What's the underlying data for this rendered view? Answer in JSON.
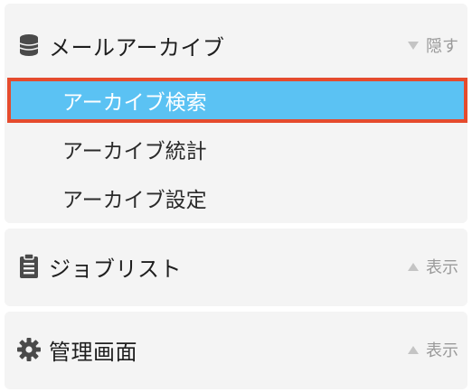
{
  "archive": {
    "title": "メールアーカイブ",
    "toggle": "隠す",
    "items": [
      {
        "label": "アーカイブ検索"
      },
      {
        "label": "アーカイブ統計"
      },
      {
        "label": "アーカイブ設定"
      }
    ],
    "icon": "database-icon"
  },
  "jobs": {
    "title": "ジョブリスト",
    "toggle": "表示",
    "icon": "clipboard-list-icon"
  },
  "admin": {
    "title": "管理画面",
    "toggle": "表示",
    "icon": "gear-icon"
  },
  "colors": {
    "panel_bg": "#f4f4f4",
    "active_bg": "#5bc2f3",
    "active_border": "#e54b2d"
  }
}
